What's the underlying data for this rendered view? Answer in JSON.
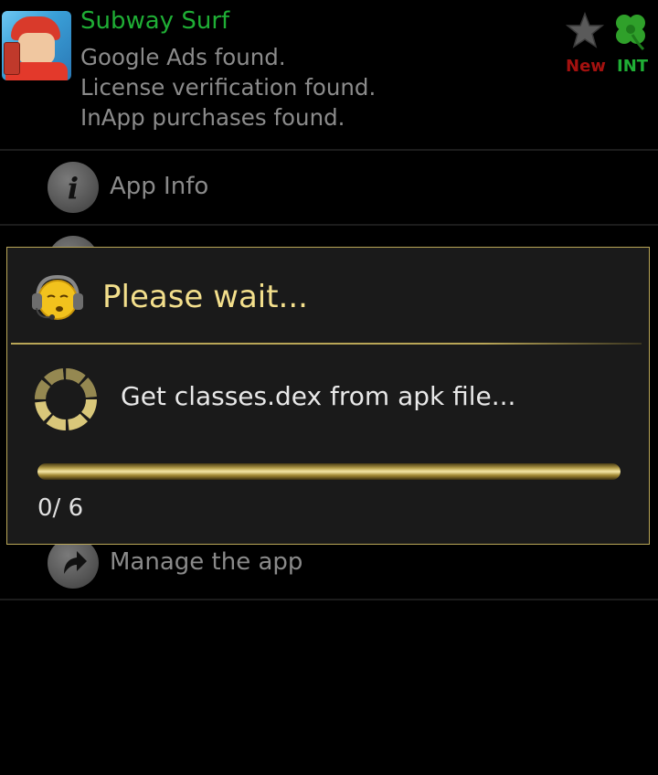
{
  "app": {
    "title": "Subway Surf",
    "lines": [
      "Google Ads found.",
      "License verification found.",
      "InApp purchases found."
    ]
  },
  "badges": {
    "new_label": "New",
    "int_label": "INT"
  },
  "menu": [
    {
      "label": "App Info",
      "icon": "info-icon"
    },
    {
      "label": "Manage the app",
      "icon": "share-arrow-icon"
    }
  ],
  "dialog": {
    "title": "Please wait...",
    "message": "Get classes.dex from apk file...",
    "progress_text": "0/ 6",
    "progress_current": 0,
    "progress_total": 6
  },
  "colors": {
    "accent_gold": "#f3df8c",
    "border_gold": "#b9a657",
    "green": "#1fae35",
    "red": "#a4110f"
  }
}
